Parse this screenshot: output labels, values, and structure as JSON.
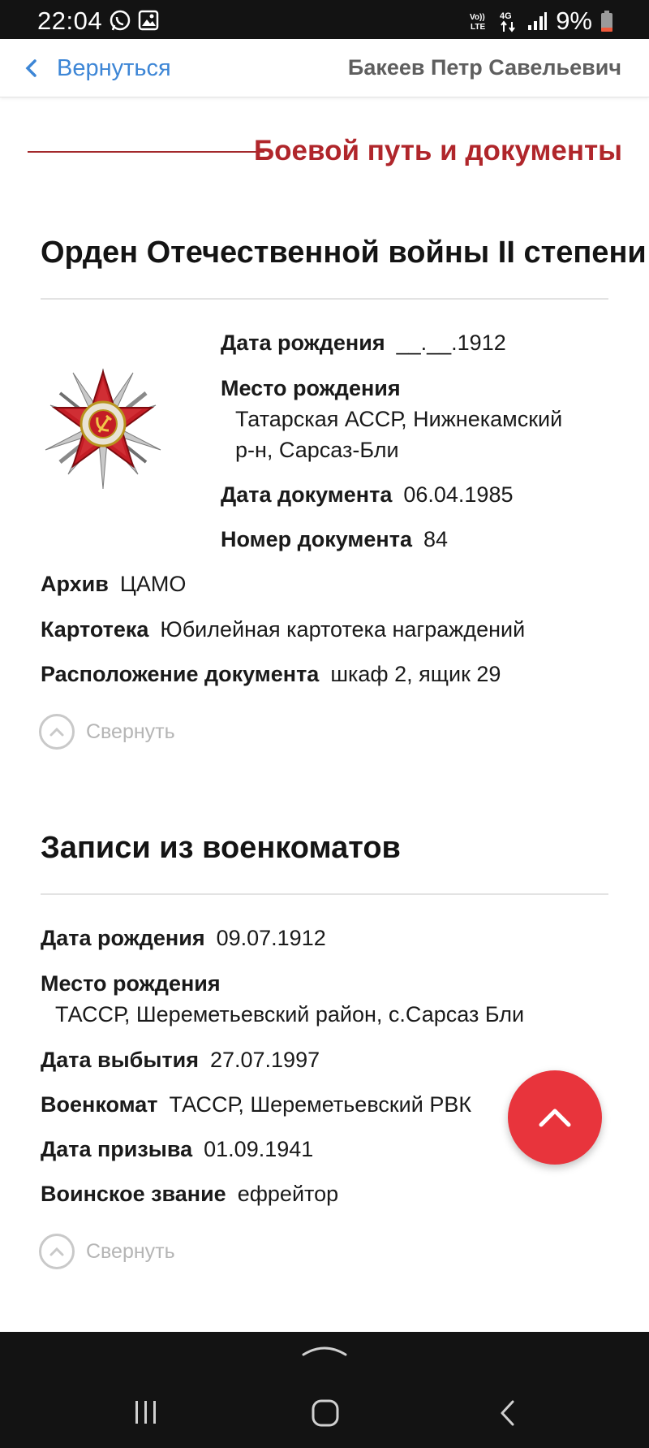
{
  "status_bar": {
    "time": "22:04",
    "network": "4G",
    "volte": "Vo)) LTE",
    "battery": "9%",
    "icons": [
      "whatsapp-icon",
      "gallery-icon",
      "signal-icon",
      "battery-icon"
    ]
  },
  "header": {
    "back_label": "Вернуться",
    "person_name": "Бакеев Петр Савельевич"
  },
  "section": {
    "title": "Боевой путь и документы"
  },
  "award_card": {
    "title": "Орден Отечественной войны II степени",
    "medal_ribbon_text": "ОТЕЧЕСТВЕННАЯ ВОЙНА",
    "birth_date_label": "Дата рождения",
    "birth_date_value": "__.__.1912",
    "birth_place_label": "Место рождения",
    "birth_place_line1": "Татарская АССР, Нижнекамский",
    "birth_place_line2": "р-н, Сарсаз-Бли",
    "doc_date_label": "Дата документа",
    "doc_date_value": "06.04.1985",
    "doc_number_label": "Номер документа",
    "doc_number_value": "84",
    "archive_label": "Архив",
    "archive_value": "ЦАМО",
    "card_index_label": "Картотека",
    "card_index_value": "Юбилейная картотека награждений",
    "location_label": "Расположение документа",
    "location_value": "шкаф 2, ящик 29",
    "collapse_label": "Свернуть"
  },
  "military_card": {
    "title": "Записи из военкоматов",
    "birth_date_label": "Дата рождения",
    "birth_date_value": "09.07.1912",
    "birth_place_label": "Место рождения",
    "birth_place_value": "ТАССР, Шереметьевский район, с.Сарсаз Бли",
    "departure_label": "Дата выбытия",
    "departure_value": "27.07.1997",
    "office_label": "Военкомат",
    "office_value": "ТАССР, Шереметьевский РВК",
    "conscription_label": "Дата призыва",
    "conscription_value": "01.09.1941",
    "rank_label": "Воинское звание",
    "rank_value": "ефрейтор",
    "collapse_label": "Свернуть"
  },
  "colors": {
    "accent_red": "#b0262b",
    "fab_red": "#e8343c",
    "link_blue": "#3d86d6"
  }
}
